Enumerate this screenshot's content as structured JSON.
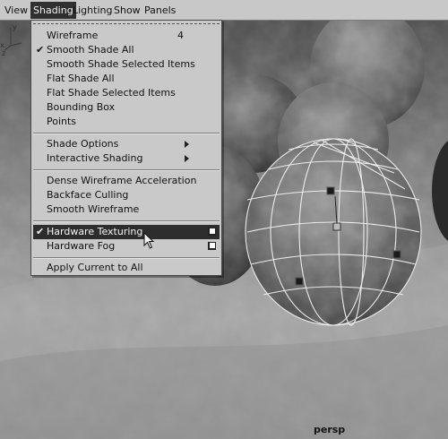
{
  "menubar": {
    "items": [
      {
        "label": "View",
        "active": false
      },
      {
        "label": "Shading",
        "active": true
      },
      {
        "label": "Lighting",
        "active": false
      },
      {
        "label": "Show",
        "active": false
      },
      {
        "label": "Panels",
        "active": false
      }
    ]
  },
  "shading_menu": {
    "wireframe": {
      "label": "Wireframe",
      "shortcut": "4",
      "checked": false
    },
    "smooth_shade_all": {
      "label": "Smooth Shade All",
      "checked": true
    },
    "smooth_shade_selected": {
      "label": "Smooth Shade Selected Items"
    },
    "flat_shade_all": {
      "label": "Flat Shade All"
    },
    "flat_shade_selected": {
      "label": "Flat Shade Selected Items"
    },
    "bounding_box": {
      "label": "Bounding Box"
    },
    "points": {
      "label": "Points"
    },
    "shade_options": {
      "label": "Shade Options",
      "submenu": true
    },
    "interactive_shading": {
      "label": "Interactive Shading",
      "submenu": true
    },
    "dense_wireframe": {
      "label": "Dense Wireframe Acceleration"
    },
    "backface_culling": {
      "label": "Backface Culling"
    },
    "smooth_wireframe": {
      "label": "Smooth Wireframe"
    },
    "hardware_texturing": {
      "label": "Hardware Texturing",
      "checked": true,
      "highlighted": true,
      "option_box": true
    },
    "hardware_fog": {
      "label": "Hardware Fog",
      "option_box": true
    },
    "apply_current": {
      "label": "Apply Current to All"
    },
    "check_glyph": "✔"
  },
  "viewport": {
    "camera_label": "persp",
    "axis": {
      "x": "x",
      "y": "y",
      "z": "z"
    }
  },
  "icons": [
    "check-icon",
    "submenu-arrow-icon",
    "option-box-icon",
    "mouse-cursor-icon",
    "axis-gizmo-icon"
  ]
}
